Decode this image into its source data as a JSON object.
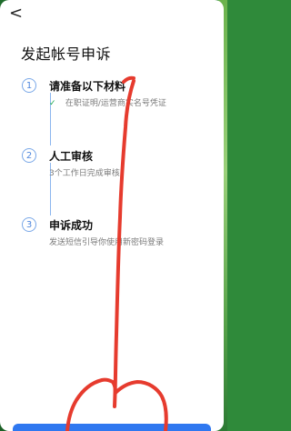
{
  "app": {
    "back_label": "<"
  },
  "page": {
    "title": "发起帐号申诉"
  },
  "steps": [
    {
      "number": "1",
      "title": "请准备以下材料",
      "subtitle": "在职证明/运营商实名号凭证",
      "status": "done"
    },
    {
      "number": "2",
      "title": "人工审核",
      "subtitle": "3个工作日完成审核",
      "status": "pending"
    },
    {
      "number": "3",
      "title": "申诉成功",
      "subtitle": "发送短信引导你使用新密码登录",
      "status": "pending"
    }
  ],
  "colors": {
    "primary": "#2f78f0",
    "step_border": "#7aa8e8",
    "check": "#19a84f",
    "annotation": "#e63b2e"
  },
  "icons": {
    "back": "back-icon",
    "check": "check-icon"
  }
}
